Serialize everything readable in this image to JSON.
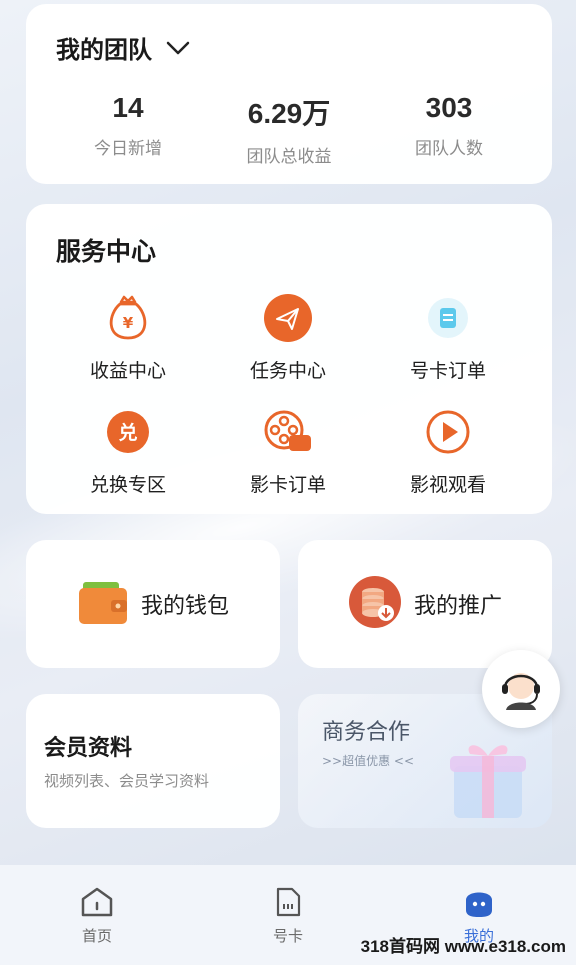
{
  "team": {
    "title": "我的团队",
    "stats": [
      {
        "value": "14",
        "label": "今日新增"
      },
      {
        "value": "6.29万",
        "label": "团队总收益"
      },
      {
        "value": "303",
        "label": "团队人数"
      }
    ]
  },
  "service": {
    "title": "服务中心",
    "items": [
      {
        "label": "收益中心",
        "icon": "money-bag-icon"
      },
      {
        "label": "任务中心",
        "icon": "paper-plane-icon"
      },
      {
        "label": "号卡订单",
        "icon": "sim-card-icon"
      },
      {
        "label": "兑换专区",
        "icon": "exchange-icon"
      },
      {
        "label": "影卡订单",
        "icon": "film-reel-icon"
      },
      {
        "label": "影视观看",
        "icon": "play-icon"
      }
    ]
  },
  "wallet": {
    "label": "我的钱包",
    "icon": "wallet-icon"
  },
  "promote": {
    "label": "我的推广",
    "icon": "coins-icon"
  },
  "member": {
    "title": "会员资料",
    "subtitle": "视频列表、会员学习资料"
  },
  "business": {
    "title": "商务合作",
    "subtitle": ">>超值优惠 <<",
    "icon": "gift-box-icon"
  },
  "support": {
    "icon": "customer-service-icon"
  },
  "tabbar": {
    "tabs": [
      {
        "label": "首页",
        "icon": "home-icon"
      },
      {
        "label": "号卡",
        "icon": "sim-card-icon"
      },
      {
        "label": "我的",
        "icon": "profile-icon"
      }
    ],
    "active": "我的"
  },
  "watermark": "318首码网 www.e318.com",
  "colors": {
    "accent": "#e8662a",
    "tab_active": "#3a6fd8",
    "background": "#e6ebf3"
  }
}
